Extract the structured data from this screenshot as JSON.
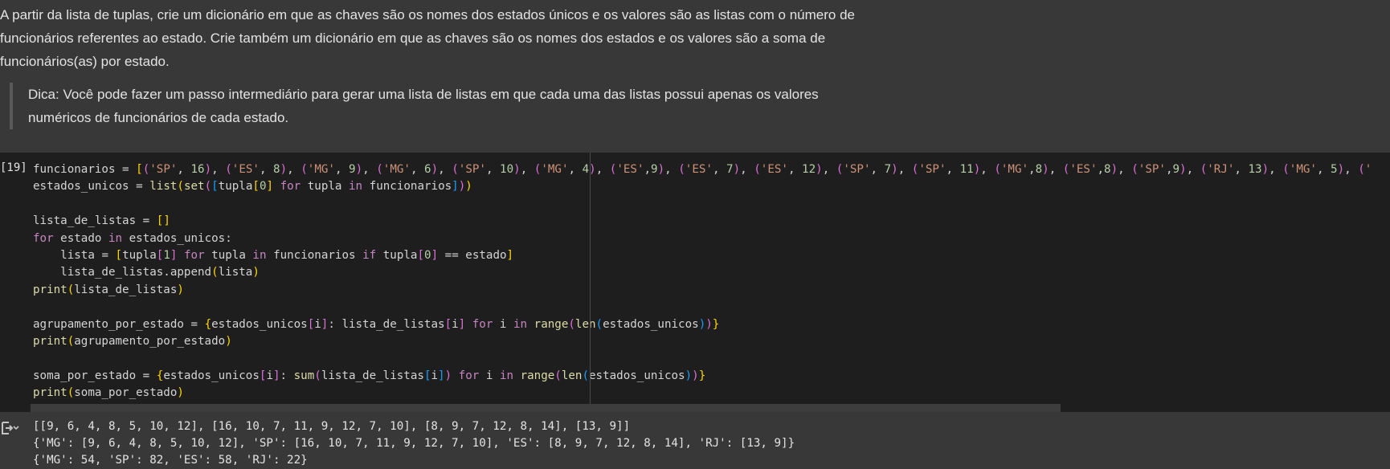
{
  "markdown": {
    "paragraph": "A partir da lista de tuplas, crie um dicionário em que as chaves são os nomes dos estados únicos e os valores são as listas com o número de funcionários referentes ao estado. Crie também um dicionário em que as chaves são os nomes dos estados e os valores são a soma de funcionários(as) por estado.",
    "tip": "Dica: Você pode fazer um passo intermediário para gerar uma lista de listas em que cada uma das listas possui apenas os valores numéricos de funcionários de cada estado."
  },
  "cell": {
    "execution_count": "[19]",
    "code_lines": [
      "funcionarios = [('SP', 16), ('ES', 8), ('MG', 9), ('MG', 6), ('SP', 10), ('MG', 4), ('ES',9), ('ES', 7), ('ES', 12), ('SP', 7), ('SP', 11), ('MG',8), ('ES',8), ('SP',9), ('RJ', 13), ('MG', 5), ('",
      "estados_unicos = list(set([tupla[0] for tupla in funcionarios]))",
      "",
      "lista_de_listas = []",
      "for estado in estados_unicos:",
      "    lista = [tupla[1] for tupla in funcionarios if tupla[0] == estado]",
      "    lista_de_listas.append(lista)",
      "print(lista_de_listas)",
      "",
      "agrupamento_por_estado = {estados_unicos[i]: lista_de_listas[i] for i in range(len(estados_unicos))}",
      "print(agrupamento_por_estado)",
      "",
      "soma_por_estado = {estados_unicos[i]: sum(lista_de_listas[i]) for i in range(len(estados_unicos))}",
      "print(soma_por_estado)"
    ],
    "output_lines": [
      "[[9, 6, 4, 8, 5, 10, 12], [16, 10, 7, 11, 9, 12, 7, 10], [8, 9, 7, 12, 8, 14], [13, 9]]",
      "{'MG': [9, 6, 4, 8, 5, 10, 12], 'SP': [16, 10, 7, 11, 9, 12, 7, 10], 'ES': [8, 9, 7, 12, 8, 14], 'RJ': [13, 9]}",
      "{'MG': 54, 'SP': 82, 'ES': 58, 'RJ': 22}"
    ]
  },
  "icons": {
    "output_toggle": "output-toggle-icon"
  }
}
